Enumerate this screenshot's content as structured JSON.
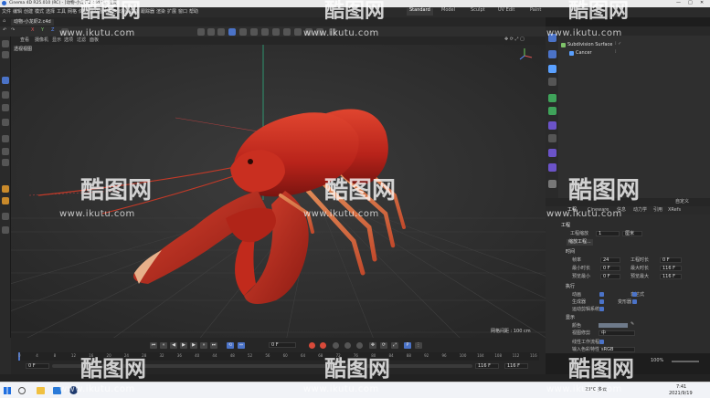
{
  "window": {
    "title": "Cinema 4D R25.010 (RC) - [动物-小龙虾2.c4d *] - 主要"
  },
  "menus": [
    "文件",
    "编辑",
    "创建",
    "模式",
    "选择",
    "工具",
    "网格",
    "体积",
    "运动图形",
    "角色",
    "动画",
    "模拟",
    "跟踪器",
    "渲染",
    "扩展",
    "窗口",
    "帮助"
  ],
  "file_tabs": [
    "动物-小龙虾2.c4d"
  ],
  "modes": {
    "items": [
      "Standard",
      "Model",
      "Sculpt",
      "UV Edit",
      "Paint"
    ],
    "active": "Standard"
  },
  "viewport": {
    "menu": [
      "查看",
      "摄像机",
      "显示",
      "选项",
      "过滤",
      "面板"
    ],
    "name": "透视视图",
    "grid_spacing": "网格间距 : 100 cm"
  },
  "object_manager": {
    "objects": [
      {
        "name": "Subdivision Surface",
        "icon": "subdivision-icon",
        "color": "#7ec36a"
      },
      {
        "name": "Cancer",
        "icon": "polygon-object-icon",
        "color": "#5aa0ff"
      }
    ]
  },
  "attributes": {
    "tabs": [
      "工程",
      "Cineware",
      "信息",
      "动力学",
      "引用",
      "XRefs"
    ],
    "mode_label": "自定义",
    "section_title": "工程",
    "project_scale_label": "工程缩放",
    "project_scale_value": "1",
    "project_scale_unit": "厘米",
    "scale_button": "缩放工程...",
    "time": {
      "title": "时间",
      "fps_label": "帧率",
      "fps_value": "24",
      "project_time_label": "工程时长",
      "project_time_value": "0 F",
      "min_time_label": "最小时长",
      "min_time_value": "0 F",
      "max_time_label": "最大时长",
      "max_time_value": "116 F",
      "preview_min_label": "预览最小",
      "preview_min_value": "0 F",
      "preview_max_label": "预览最大",
      "preview_max_value": "116 F"
    },
    "execute": {
      "title": "执行",
      "items": [
        "动画",
        "生成器",
        "运动剪辑系统",
        "表达式",
        "变形器"
      ]
    },
    "display": {
      "title": "显示",
      "color_label": "颜色",
      "view_clip_label": "视图修剪",
      "view_clip_value": "中",
      "linear_label": "线性工作流程",
      "color_profile_label": "输入色彩特性",
      "color_profile_value": "sRGB"
    }
  },
  "timeline": {
    "ticks": [
      "0",
      "4",
      "8",
      "12",
      "16",
      "20",
      "24",
      "28",
      "32",
      "36",
      "40",
      "44",
      "48",
      "52",
      "56",
      "60",
      "64",
      "68",
      "72",
      "76",
      "80",
      "84",
      "88",
      "92",
      "96",
      "100",
      "104",
      "108",
      "112",
      "116"
    ],
    "current_frame": "0 F",
    "start_field": "0 F",
    "end_field": "116 F",
    "end_field2": "116 F",
    "left_field": "0 F"
  },
  "watermark": {
    "logo_text": "酷图网",
    "url": "www.ikutu.com"
  },
  "taskbar": {
    "time": "7:41",
    "date": "2021/9/19",
    "weather": "23°C 多云",
    "zoom": "100%"
  },
  "colors": {
    "accent": "#4b73c8",
    "crayfish": "#c0261c",
    "active_mode": "#3a3a3a"
  }
}
